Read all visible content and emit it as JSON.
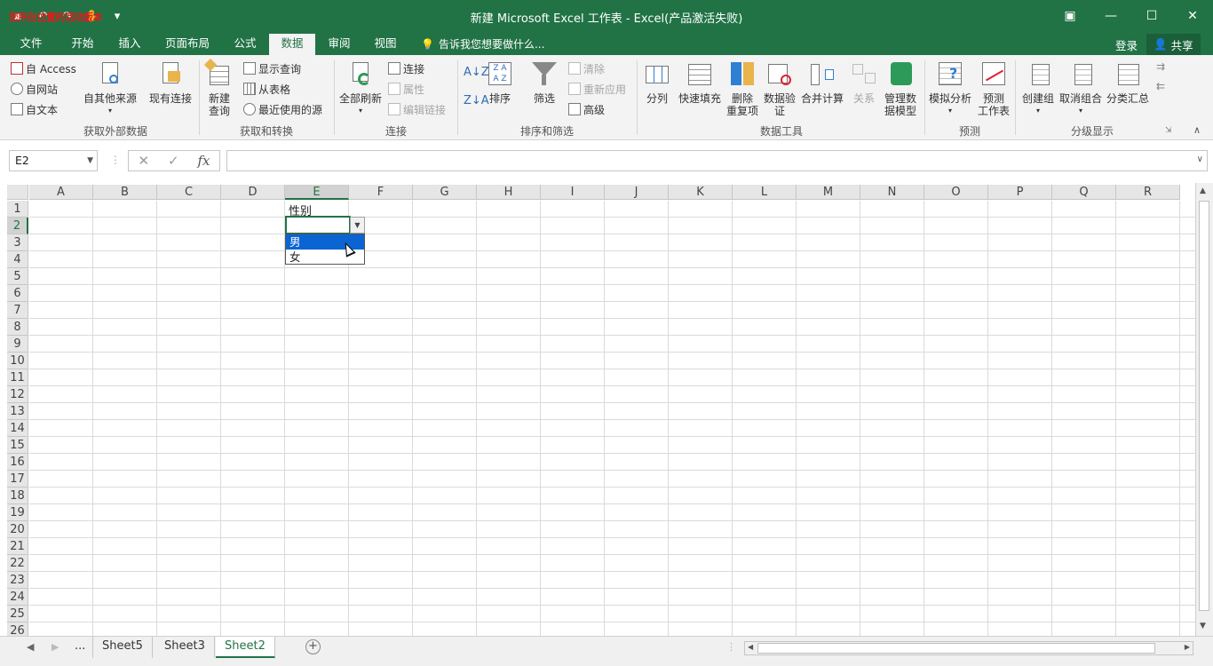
{
  "window": {
    "title": "新建 Microsoft Excel 工作表 - Excel(产品激活失败)",
    "overlay_text": "您所在位置的活动版本",
    "controls": {
      "restore_icon": "▣",
      "minimize": "—",
      "maximize": "☐",
      "close": "✕"
    }
  },
  "tabs": [
    {
      "label": "文件"
    },
    {
      "label": "开始"
    },
    {
      "label": "插入"
    },
    {
      "label": "页面布局"
    },
    {
      "label": "公式"
    },
    {
      "label": "数据"
    },
    {
      "label": "审阅"
    },
    {
      "label": "视图"
    }
  ],
  "tell_me": "告诉我您想要做什么...",
  "login": "登录",
  "share": "共享",
  "ribbon": {
    "external": {
      "access": "自 Access",
      "web": "自网站",
      "text": "自文本",
      "other": "自其他来源",
      "existing": "现有连接",
      "group": "获取外部数据"
    },
    "transform": {
      "new_query": "新建",
      "new_query2": "查询",
      "show_queries": "显示查询",
      "from_table": "从表格",
      "recent": "最近使用的源",
      "group": "获取和转换"
    },
    "connections": {
      "refresh_all": "全部刷新",
      "connections": "连接",
      "properties": "属性",
      "edit_links": "编辑链接",
      "group": "连接"
    },
    "sort_filter": {
      "sort": "排序",
      "filter": "筛选",
      "clear": "清除",
      "reapply": "重新应用",
      "advanced": "高级",
      "group": "排序和筛选"
    },
    "data_tools": {
      "split": "分列",
      "flash_fill": "快速填充",
      "remove_dup": "删除",
      "remove_dup2": "重复项",
      "validation": "数据验",
      "validation2": "证",
      "consolidate": "合并计算",
      "relations": "关系",
      "manage_model": "管理数",
      "manage_model2": "据模型",
      "group": "数据工具"
    },
    "forecast": {
      "whatif": "模拟分析",
      "sheet": "预测",
      "sheet2": "工作表",
      "group": "预测"
    },
    "outline": {
      "group_btn": "创建组",
      "ungroup": "取消组合",
      "subtotal": "分类汇总",
      "group": "分级显示"
    }
  },
  "formula_bar": {
    "name_box": "E2",
    "cancel": "✕",
    "enter": "✓",
    "fx": "fx",
    "value": ""
  },
  "columns": [
    "A",
    "B",
    "C",
    "D",
    "E",
    "F",
    "G",
    "H",
    "I",
    "J",
    "K",
    "L",
    "M",
    "N",
    "O",
    "P",
    "Q",
    "R"
  ],
  "rows": [
    "1",
    "2",
    "3",
    "4",
    "5",
    "6",
    "7",
    "8",
    "9",
    "10",
    "11",
    "12",
    "13",
    "14",
    "15",
    "16",
    "17",
    "18",
    "19",
    "20",
    "21",
    "22",
    "23",
    "24",
    "25",
    "26"
  ],
  "cells": {
    "E1": "性别"
  },
  "dropdown": {
    "options": [
      "男",
      "女"
    ],
    "highlighted": 0
  },
  "sheets": {
    "ellipsis": "...",
    "list": [
      "Sheet5",
      "Sheet3",
      "Sheet2"
    ],
    "active": "Sheet2",
    "add": "+"
  }
}
